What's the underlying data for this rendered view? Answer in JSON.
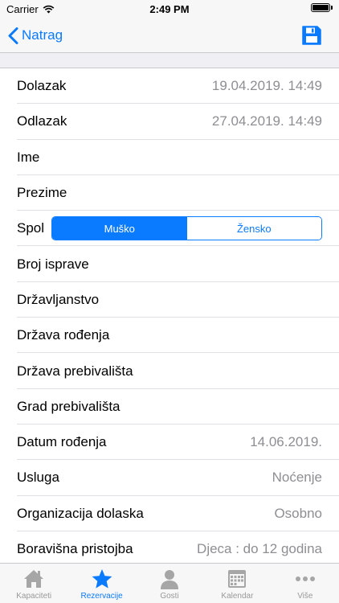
{
  "status_bar": {
    "carrier": "Carrier",
    "time": "2:49 PM"
  },
  "nav": {
    "back_label": "Natrag"
  },
  "colors": {
    "accent": "#0a7aff",
    "secondary_text": "#8e8e93",
    "inactive_tab": "#999999"
  },
  "form": {
    "rows": [
      {
        "label": "Dolazak",
        "value": "19.04.2019. 14:49"
      },
      {
        "label": "Odlazak",
        "value": "27.04.2019. 14:49"
      },
      {
        "label": "Ime",
        "value": ""
      },
      {
        "label": "Prezime",
        "value": ""
      },
      {
        "label": "Broj isprave",
        "value": ""
      },
      {
        "label": "Državljanstvo",
        "value": ""
      },
      {
        "label": "Država rođenja",
        "value": ""
      },
      {
        "label": "Država prebivališta",
        "value": ""
      },
      {
        "label": "Grad prebivališta",
        "value": ""
      },
      {
        "label": "Datum rođenja",
        "value": "14.06.2019."
      },
      {
        "label": "Usluga",
        "value": "Noćenje"
      },
      {
        "label": "Organizacija dolaska",
        "value": "Osobno"
      },
      {
        "label": "Boravišna pristojba",
        "value": "Djeca : do 12 godina"
      }
    ],
    "gender": {
      "label": "Spol",
      "options": [
        "Muško",
        "Žensko"
      ],
      "selected": "Muško"
    }
  },
  "tab_bar": {
    "tabs": [
      {
        "label": "Kapaciteti",
        "icon": "house-icon"
      },
      {
        "label": "Rezervacije",
        "icon": "star-icon"
      },
      {
        "label": "Gosti",
        "icon": "person-icon"
      },
      {
        "label": "Kalendar",
        "icon": "calendar-icon"
      },
      {
        "label": "Više",
        "icon": "more-icon"
      }
    ],
    "active": "Rezervacije"
  }
}
